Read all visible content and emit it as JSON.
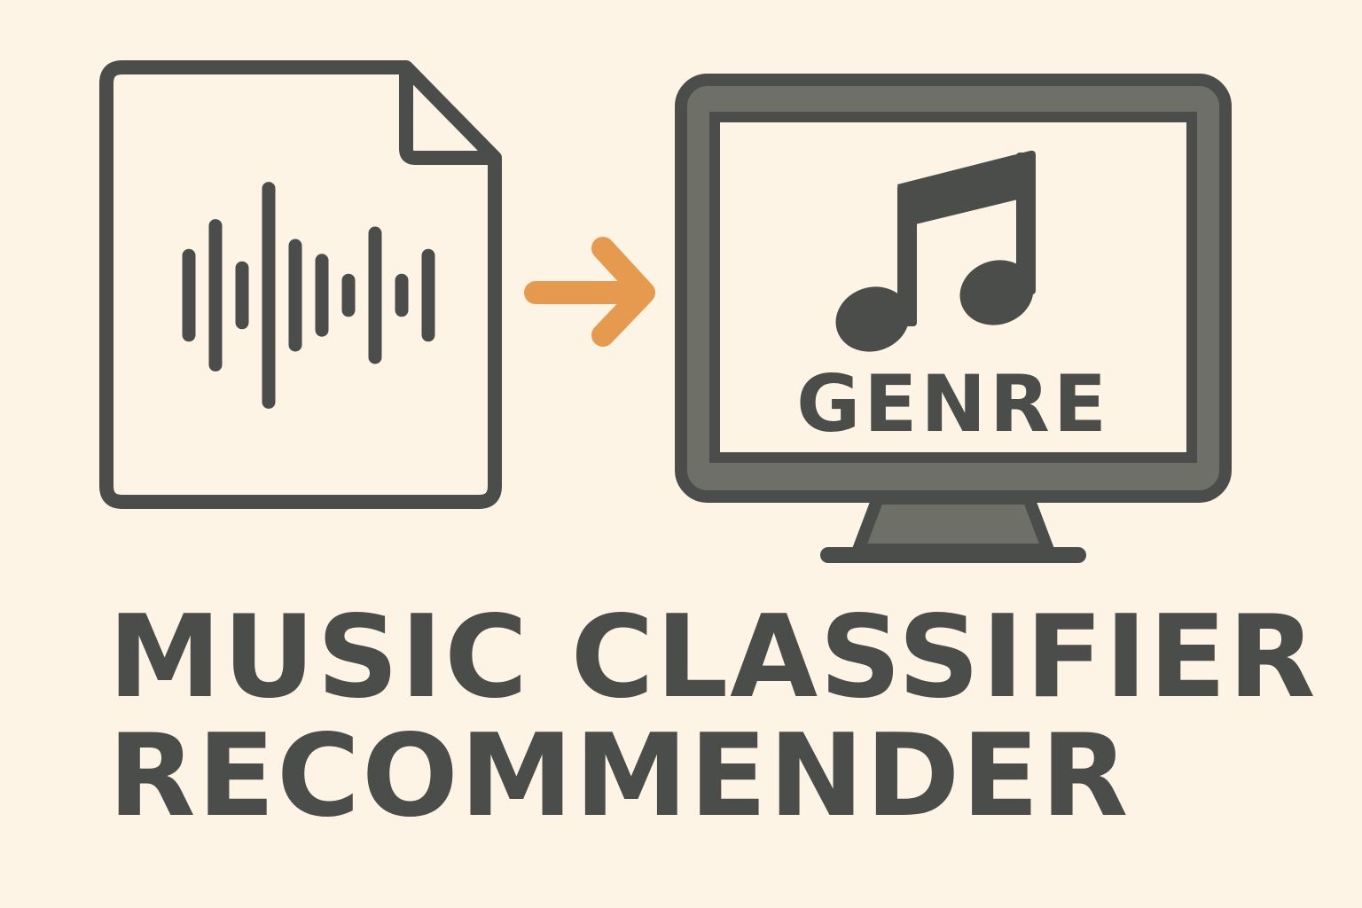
{
  "diagram": {
    "screen_label": "GENRE",
    "title_lines": [
      "MUSIC CLASSIFIER",
      "RECOMMENDER"
    ],
    "waveform_levels": [
      0.32,
      0.56,
      0.22,
      0.86,
      0.4,
      0.28,
      0.12,
      0.5,
      0.12,
      0.32
    ],
    "icons": {
      "input": "audio-file-icon",
      "flow": "arrow-right-icon",
      "output": "monitor-icon",
      "symbol": "music-note-icon"
    },
    "colors": {
      "background": "#fdf4e5",
      "ink": "#4a4d49",
      "monitor_frame": "#6e7068",
      "arrow": "#e69a4f"
    }
  }
}
